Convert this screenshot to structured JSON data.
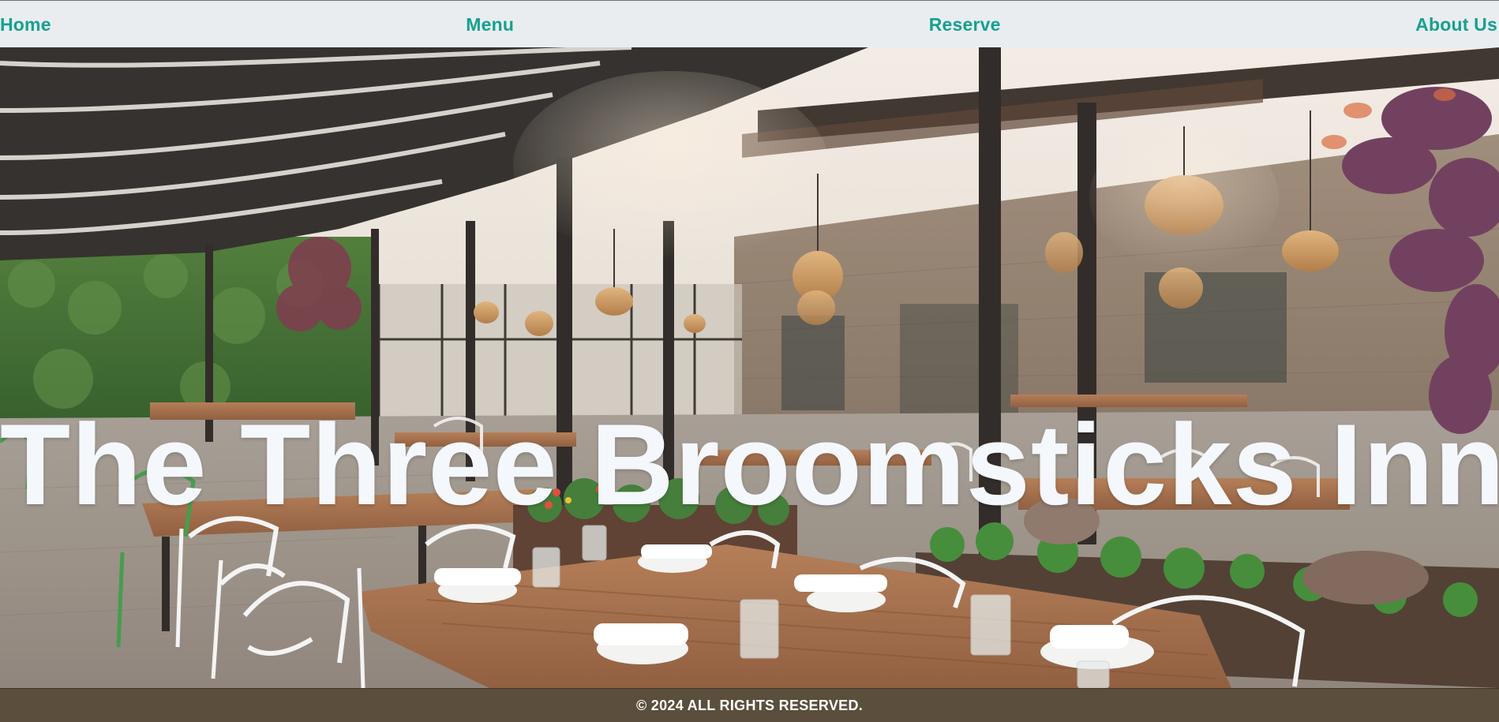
{
  "nav": {
    "items": [
      {
        "label": "Home"
      },
      {
        "label": "Menu"
      },
      {
        "label": "Reserve"
      },
      {
        "label": "About Us"
      }
    ]
  },
  "hero": {
    "title": "The Three Broomsticks Inn",
    "image": "restaurant-patio-photo"
  },
  "footer": {
    "copyright": "© 2024 ALL RIGHTS RESERVED."
  },
  "colors": {
    "nav_bg": "#e9edf0",
    "nav_link": "#16a08f",
    "footer_bg": "#5b4e3c",
    "title_text": "#f4f7fb"
  }
}
